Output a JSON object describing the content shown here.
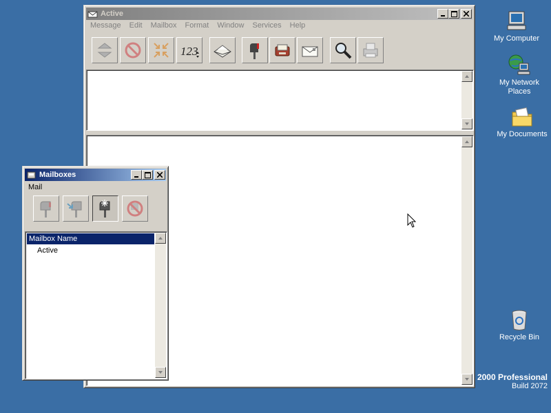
{
  "main_window": {
    "title": "Active",
    "menu": [
      "Message",
      "Edit",
      "Mailbox",
      "Format",
      "Window",
      "Services",
      "Help"
    ],
    "toolbar_icons": [
      "up-down-arrows-icon",
      "stop-icon",
      "compress-arrows-icon",
      "number-sequence-icon",
      "open-envelope-icon",
      "mailbox-flag-icon",
      "address-book-icon",
      "envelope-icon",
      "magnifier-icon",
      "printer-icon"
    ],
    "sequence_icon_text": "123"
  },
  "mailboxes_window": {
    "title": "Mailboxes",
    "menu": [
      "Mail"
    ],
    "toolbar_icons": [
      "mailbox-icon",
      "mailbox-arrow-icon",
      "new-mailbox-icon",
      "delete-mailbox-icon"
    ],
    "list_header": "Mailbox Name",
    "rows": [
      "Active"
    ]
  },
  "desktop": {
    "icons": [
      {
        "label": "My Computer",
        "icon": "computer-icon"
      },
      {
        "label": "My Network Places",
        "icon": "network-icon"
      },
      {
        "label": "My Documents",
        "icon": "folder-icon"
      },
      {
        "label": "Recycle Bin",
        "icon": "recycle-bin-icon"
      }
    ],
    "build_line1": "2000 Professional",
    "build_line2": "Build 2072"
  },
  "colors": {
    "desktop": "#3a6ea5",
    "title_active": "#0a246a",
    "title_inactive": "#808080",
    "face": "#d4d0c8"
  }
}
